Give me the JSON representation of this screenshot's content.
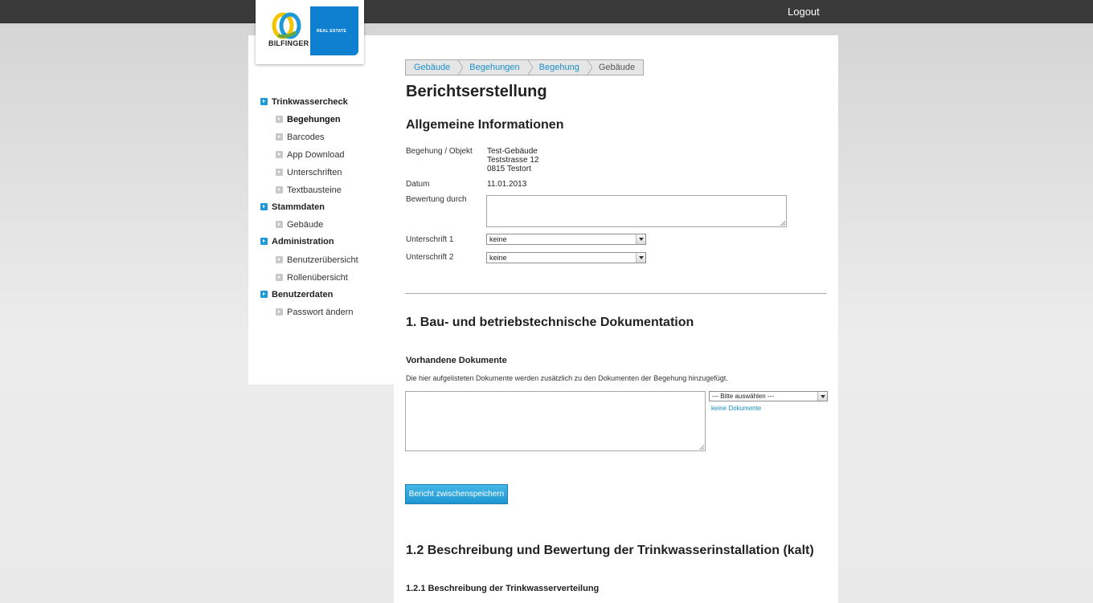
{
  "header": {
    "logout_label": "Logout"
  },
  "logo": {
    "brand": "BILFINGER",
    "division": "REAL ESTATE",
    "accent": "#0f7fd0"
  },
  "nav": {
    "sections": [
      {
        "label": "Trinkwassercheck",
        "items": [
          "Begehungen",
          "Barcodes",
          "App Download",
          "Unterschriften",
          "Textbausteine"
        ]
      },
      {
        "label": "Stammdaten",
        "items": [
          "Gebäude"
        ]
      },
      {
        "label": "Administration",
        "items": [
          "Benutzerübersicht",
          "Rollenübersicht"
        ]
      },
      {
        "label": "Benutzerdaten",
        "items": [
          "Passwort ändern"
        ]
      }
    ],
    "active_item": "Begehungen"
  },
  "breadcrumb": [
    "Gebäude",
    "Begehungen",
    "Begehung",
    "Gebäude"
  ],
  "page": {
    "title": "Berichtserstellung",
    "general_heading": "Allgemeine Informationen",
    "fields": {
      "object_label": "Begehung / Objekt",
      "object_lines": [
        "Test-Gebäude",
        "Teststrasse 12",
        "0815 Testort"
      ],
      "date_label": "Datum",
      "date_value": "11.01.2013",
      "rating_label": "Bewertung durch",
      "rating_value": "",
      "sig1_label": "Unterschrift 1",
      "sig1_value": "keine",
      "sig2_label": "Unterschrift 2",
      "sig2_value": "keine"
    },
    "section1": {
      "heading": "1. Bau- und betriebstechnische Dokumentation",
      "docs_heading": "Vorhandene Dokumente",
      "docs_note": "Die hier aufgelisteten Dokumente werden zusätzlich zu den Dokumenten der Begehung hinzugefügt.",
      "docs_textarea": "",
      "docs_select": "--- Bitte auswählen ---",
      "no_docs_link": "keine Dokumente",
      "save_button": "Bericht zwischenspeichern"
    },
    "section12": {
      "heading": "1.2 Beschreibung und Bewertung der Trinkwasserinstallation (kalt)",
      "sub_heading": "1.2.1 Beschreibung der Trinkwasserverteilung"
    }
  },
  "colors": {
    "topbar": "#3a3a3a",
    "accent": "#1e9ad6",
    "link": "#1a8fc8"
  }
}
